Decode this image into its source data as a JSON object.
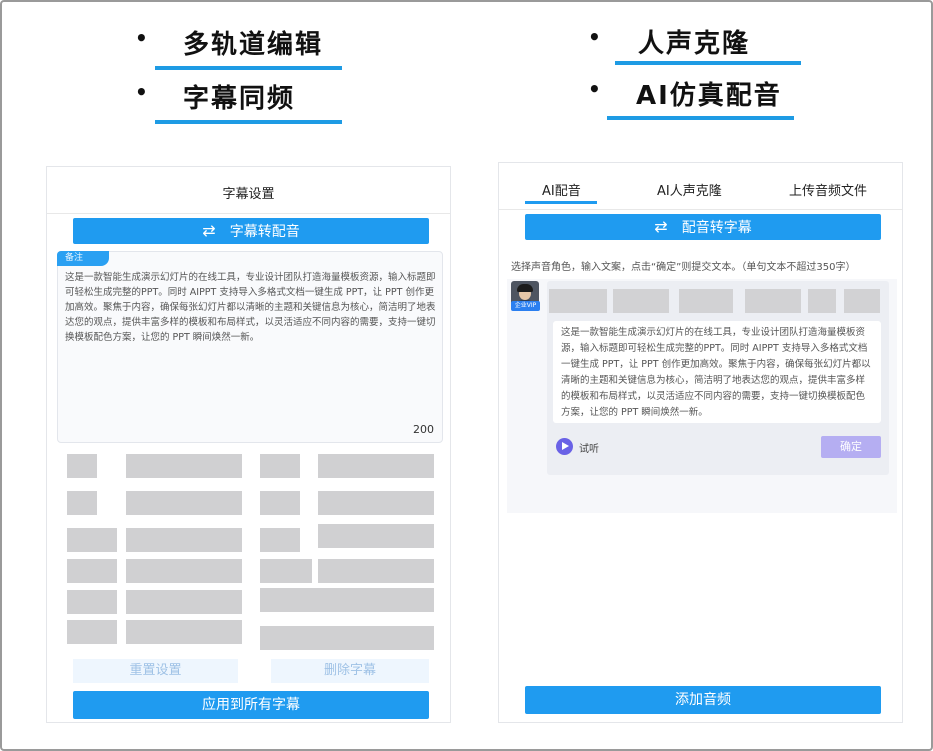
{
  "features": {
    "left": [
      "多轨道编辑",
      "字幕同频"
    ],
    "right": [
      "人声克隆",
      "AI仿真配音"
    ]
  },
  "left_panel": {
    "title": "字幕设置",
    "convert_button": "字幕转配音",
    "note_tag": "备注",
    "note_text": "这是一款智能生成演示幻灯片的在线工具，专业设计团队打造海量模板资源，输入标题即可轻松生成完整的PPT。同时 AIPPT 支持导入多格式文档一键生成 PPT，让 PPT 创作更加高效。聚焦于内容，确保每张幻灯片都以清晰的主题和关键信息为核心，简洁明了地表达您的观点，提供丰富多样的模板和布局样式，以灵活适应不同内容的需要，支持一键切换模板配色方案，让您的 PPT 瞬间焕然一新。",
    "note_count": "200",
    "reset_button": "重置设置",
    "delete_button": "删除字幕",
    "apply_button": "应用到所有字幕"
  },
  "right_panel": {
    "tabs": [
      "AI配音",
      "AI人声克隆",
      "上传音频文件"
    ],
    "active_tab": "AI配音",
    "convert_button": "配音转字幕",
    "hint": "选择声音角色，输入文案，点击“确定”则提交文本。（单句文本不超过350字）",
    "vip_badge": "企业VIP",
    "card_text": "这是一款智能生成演示幻灯片的在线工具，专业设计团队打造海量模板资源，输入标题即可轻松生成完整的PPT。同时 AIPPT 支持导入多格式文档一键生成 PPT，让 PPT 创作更加高效。聚焦于内容，确保每张幻灯片都以清晰的主题和关键信息为核心，简洁明了地表达您的观点，提供丰富多样的模板和布局样式，以灵活适应不同内容的需要，支持一键切换模板配色方案，让您的 PPT 瞬间焕然一新。",
    "listen_label": "试听",
    "confirm_button": "确定",
    "add_audio_button": "添加音频"
  },
  "colors": {
    "accent": "#1f9bf0",
    "underline": "#1e9be4",
    "confirm": "#b5aef2",
    "play": "#6a62e6"
  }
}
